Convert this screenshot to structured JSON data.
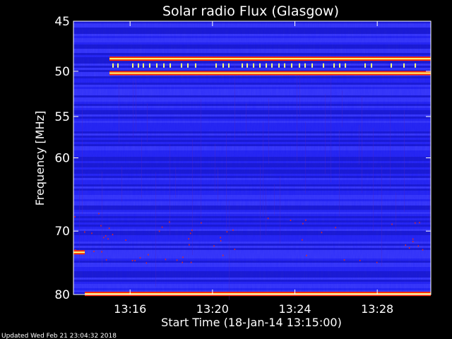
{
  "chart_data": {
    "type": "heatmap",
    "title": "Solar radio Flux (Glasgow)",
    "xlabel": "Start Time (18-Jan-14 13:15:00)",
    "ylabel": "Frequency [MHz]",
    "footer": "Updated Wed Feb 21 23:04:32 2018",
    "x_range_minutes": [
      13.25,
      15.0
    ],
    "x_ticks": [
      {
        "label": "13:16",
        "minutes": 16
      },
      {
        "label": "13:20",
        "minutes": 20
      },
      {
        "label": "13:24",
        "minutes": 24
      },
      {
        "label": "13:28",
        "minutes": 28
      }
    ],
    "y_range_mhz": [
      45,
      80
    ],
    "y_scale": "log",
    "y_ticks": [
      45,
      50,
      55,
      60,
      70,
      80
    ],
    "colors": {
      "background": "#000000",
      "spectrum_base": "#2a2af0",
      "spectrum_dark": "#1414b4",
      "spectrum_light": "#4a4aff",
      "interference": "#ff2a00",
      "hot": "#ffff7a"
    },
    "interference_bands": [
      {
        "freq_mhz": 48.7,
        "intensity": "strong",
        "span_minutes": [
          15.0,
          30.0
        ]
      },
      {
        "freq_mhz": 49.4,
        "intensity": "bursty",
        "span_minutes": [
          15.0,
          30.0
        ]
      },
      {
        "freq_mhz": 50.2,
        "intensity": "strong",
        "span_minutes": [
          15.0,
          30.0
        ]
      },
      {
        "freq_mhz": 73.2,
        "intensity": "strong",
        "span_minutes": [
          13.25,
          13.8
        ]
      },
      {
        "freq_mhz": 79.9,
        "intensity": "strong",
        "span_minutes": [
          13.8,
          30.0
        ]
      }
    ],
    "grid": false,
    "legend": "none"
  }
}
